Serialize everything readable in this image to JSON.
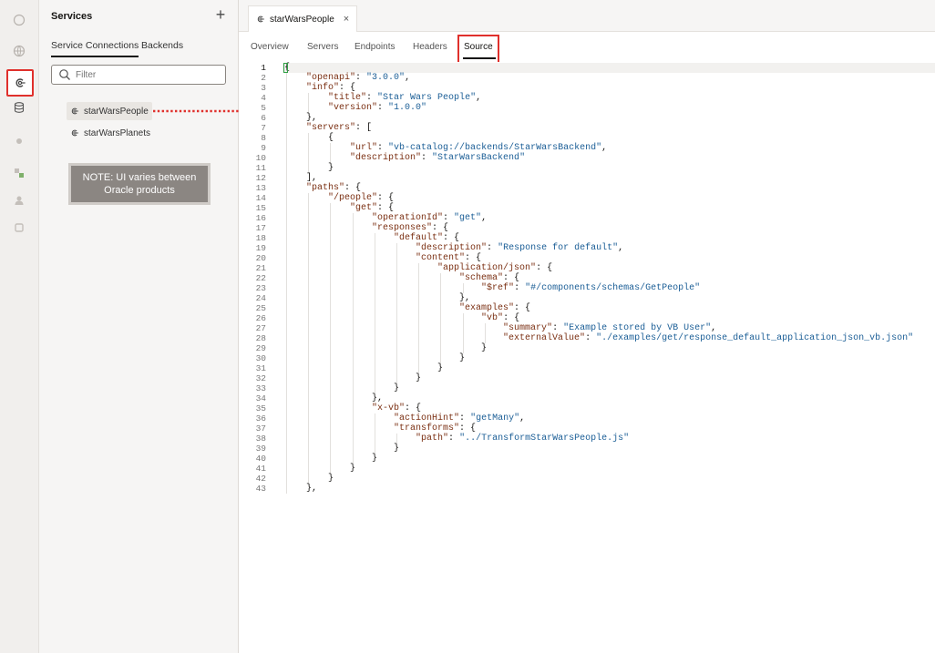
{
  "rail": {
    "icons": [
      "app-icon",
      "globe-icon",
      "service-connection-icon",
      "database-icon",
      "component-icon",
      "process-icon",
      "user-icon",
      "settings-icon"
    ]
  },
  "panel": {
    "title": "Services",
    "add_label": "+",
    "tabs": [
      {
        "label": "Service Connections",
        "active": true
      },
      {
        "label": "Backends",
        "active": false
      }
    ],
    "filter_placeholder": "Filter",
    "items": [
      {
        "label": "starWarsPeople",
        "selected": true
      },
      {
        "label": "starWarsPlanets",
        "selected": false
      }
    ],
    "note_line1": "NOTE: UI varies between",
    "note_line2": "Oracle products"
  },
  "editor": {
    "file_tab": "starWarsPeople",
    "close_label": "×",
    "subtabs": [
      "Overview",
      "Servers",
      "Endpoints",
      "Headers",
      "Source"
    ],
    "active_subtab": "Source"
  },
  "code": {
    "line_numbers": [
      "1",
      "2",
      "3",
      "4",
      "5",
      "6",
      "7",
      "8",
      "9",
      "10",
      "11",
      "12",
      "13",
      "14",
      "15",
      "16",
      "17",
      "18",
      "19",
      "20",
      "21",
      "22",
      "23",
      "24",
      "25",
      "26",
      "27",
      "28",
      "29",
      "30",
      "31",
      "32",
      "33",
      "34",
      "35",
      "36",
      "37",
      "38",
      "39",
      "40",
      "41",
      "42",
      "43"
    ],
    "lines": [
      "{",
      "    \"openapi\": \"3.0.0\",",
      "    \"info\": {",
      "        \"title\": \"Star Wars People\",",
      "        \"version\": \"1.0.0\"",
      "    },",
      "    \"servers\": [",
      "        {",
      "            \"url\": \"vb-catalog://backends/StarWarsBackend\",",
      "            \"description\": \"StarWarsBackend\"",
      "        }",
      "    ],",
      "    \"paths\": {",
      "        \"/people\": {",
      "            \"get\": {",
      "                \"operationId\": \"get\",",
      "                \"responses\": {",
      "                    \"default\": {",
      "                        \"description\": \"Response for default\",",
      "                        \"content\": {",
      "                            \"application/json\": {",
      "                                \"schema\": {",
      "                                    \"$ref\": \"#/components/schemas/GetPeople\"",
      "                                },",
      "                                \"examples\": {",
      "                                    \"vb\": {",
      "                                        \"summary\": \"Example stored by VB User\",",
      "                                        \"externalValue\": \"./examples/get/response_default_application_json_vb.json\"",
      "                                    }",
      "                                }",
      "                            }",
      "                        }",
      "                    }",
      "                },",
      "                \"x-vb\": {",
      "                    \"actionHint\": \"getMany\",",
      "                    \"transforms\": {",
      "                        \"path\": \"../TransformStarWarsPeople.js\"",
      "                    }",
      "                }",
      "            }",
      "        }",
      "    },"
    ],
    "colors": {
      "key": "#7a2f12",
      "string": "#1b5e96",
      "punct": "#161513"
    }
  }
}
